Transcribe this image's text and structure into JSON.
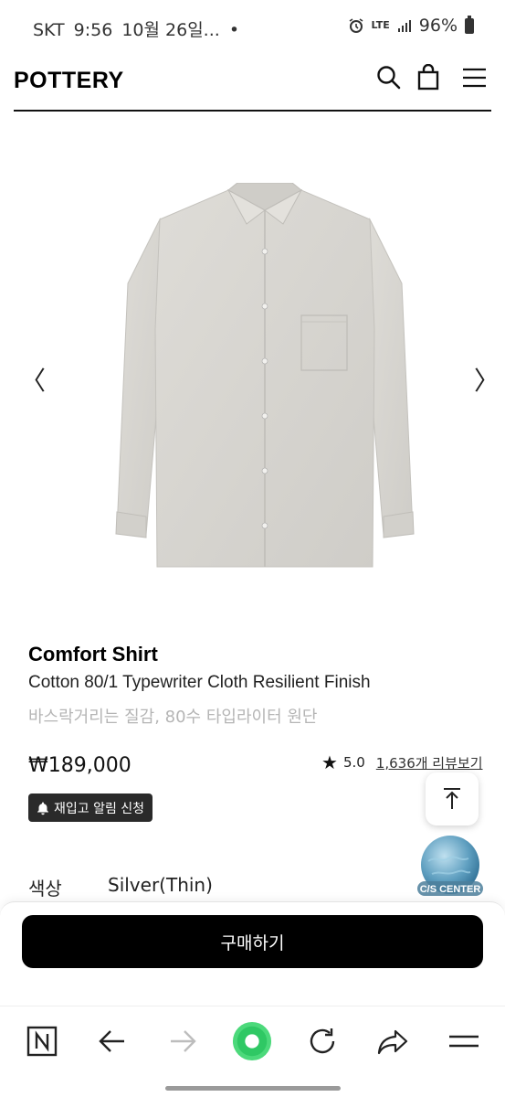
{
  "status_bar": {
    "carrier": "SKT",
    "time": "9:56",
    "date": "10월 26일...",
    "dot": "•",
    "network": "LTE",
    "battery": "96%"
  },
  "header": {
    "logo": "POTTERY",
    "icons": [
      "search-icon",
      "bag-icon",
      "menu-icon"
    ]
  },
  "gallery": {
    "prev": "〈",
    "next": "〉",
    "image_alt": "light grey button-down shirt",
    "shirt_color": "#d9d7d2"
  },
  "product": {
    "name": "Comfort Shirt",
    "subtitle": "Cotton 80/1 Typewriter Cloth Resilient Finish",
    "desc_ko": "바스락거리는 질감, 80수 타입라이터 원단",
    "price": "₩189,000",
    "rating": "5.0",
    "reviews": "1,636개 리뷰보기",
    "restock_label": "재입고 알림 신청",
    "color_label": "색상",
    "color_value": "Silver(Thin)"
  },
  "floating": {
    "cs_label": "C/S CENTER"
  },
  "buy": {
    "label": "구매하기",
    "bg": "#000000"
  },
  "browser_bar": {
    "items": [
      "n-icon",
      "back-icon",
      "forward-icon",
      "home-icon",
      "refresh-icon",
      "share-icon",
      "menu-icon"
    ],
    "accent": "#4cd97b"
  }
}
